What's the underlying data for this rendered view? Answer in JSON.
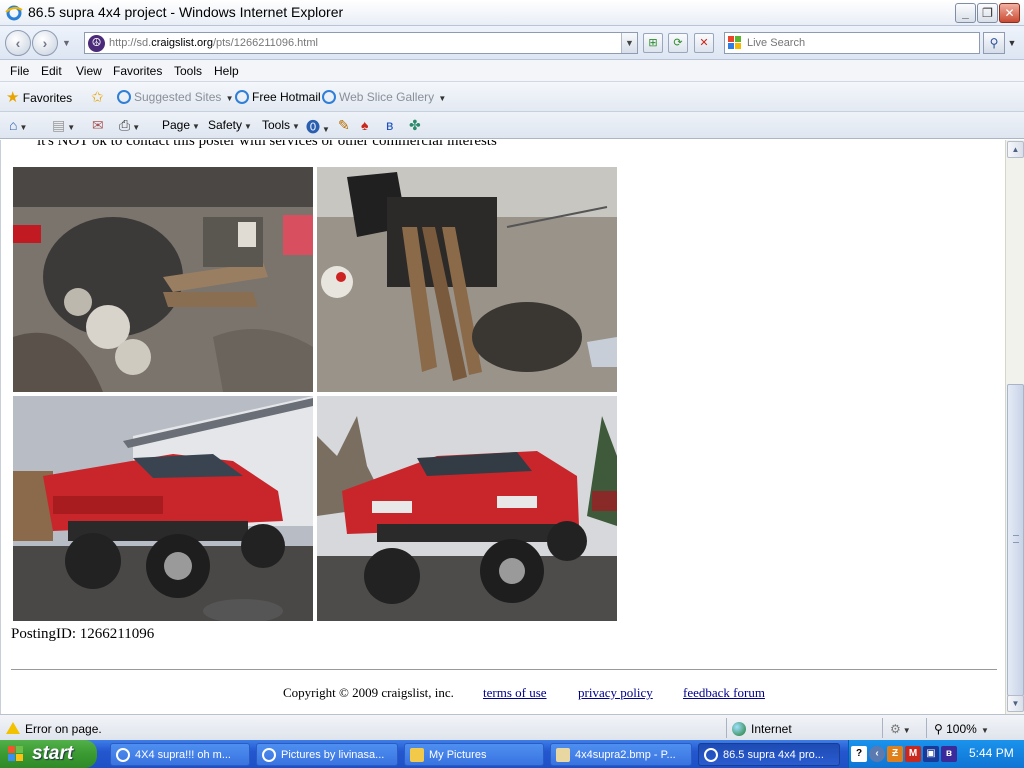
{
  "window": {
    "title": "86.5 supra 4x4 project - Windows Internet Explorer",
    "minimize": "_",
    "restore": "❐",
    "close": "✕"
  },
  "address": {
    "url_prefix": "http://sd.",
    "url_domain": "craigslist.org",
    "url_path": "/pts/1266211096.html",
    "search_placeholder": "Live Search"
  },
  "menu": [
    "File",
    "Edit",
    "View",
    "Favorites",
    "Tools",
    "Help"
  ],
  "favorites": {
    "label": "Favorites",
    "items": [
      "Suggested Sites",
      "Free Hotmail",
      "Web Slice Gallery"
    ]
  },
  "commands": {
    "page": "Page",
    "safety": "Safety",
    "tools": "Tools"
  },
  "content": {
    "clipped_line": "it's NOT ok to contact this poster with services or other commercial interests",
    "posting_id": "PostingID: 1266211096",
    "photos": [
      {
        "subject": "engine parts on ground"
      },
      {
        "subject": "engine and exhaust headers"
      },
      {
        "subject": "red supra rear lifted"
      },
      {
        "subject": "red supra front lifted"
      }
    ],
    "footer": {
      "copyright": "Copyright © 2009 craigslist, inc.",
      "terms": "terms of use",
      "privacy": "privacy policy",
      "feedback": "feedback forum"
    }
  },
  "status": {
    "message": "Error on page.",
    "zone": "Internet",
    "zoom": "100%"
  },
  "taskbar": {
    "start": "start",
    "tasks": [
      "4X4 supra!!! oh m...",
      "Pictures by livinasa...",
      "My Pictures",
      "4x4supra2.bmp - P...",
      "86.5 supra 4x4 pro..."
    ],
    "clock": "5:44 PM"
  },
  "colors": {
    "link": "#00008b",
    "taskbar": "#2457cf",
    "start": "#3a9a31"
  }
}
